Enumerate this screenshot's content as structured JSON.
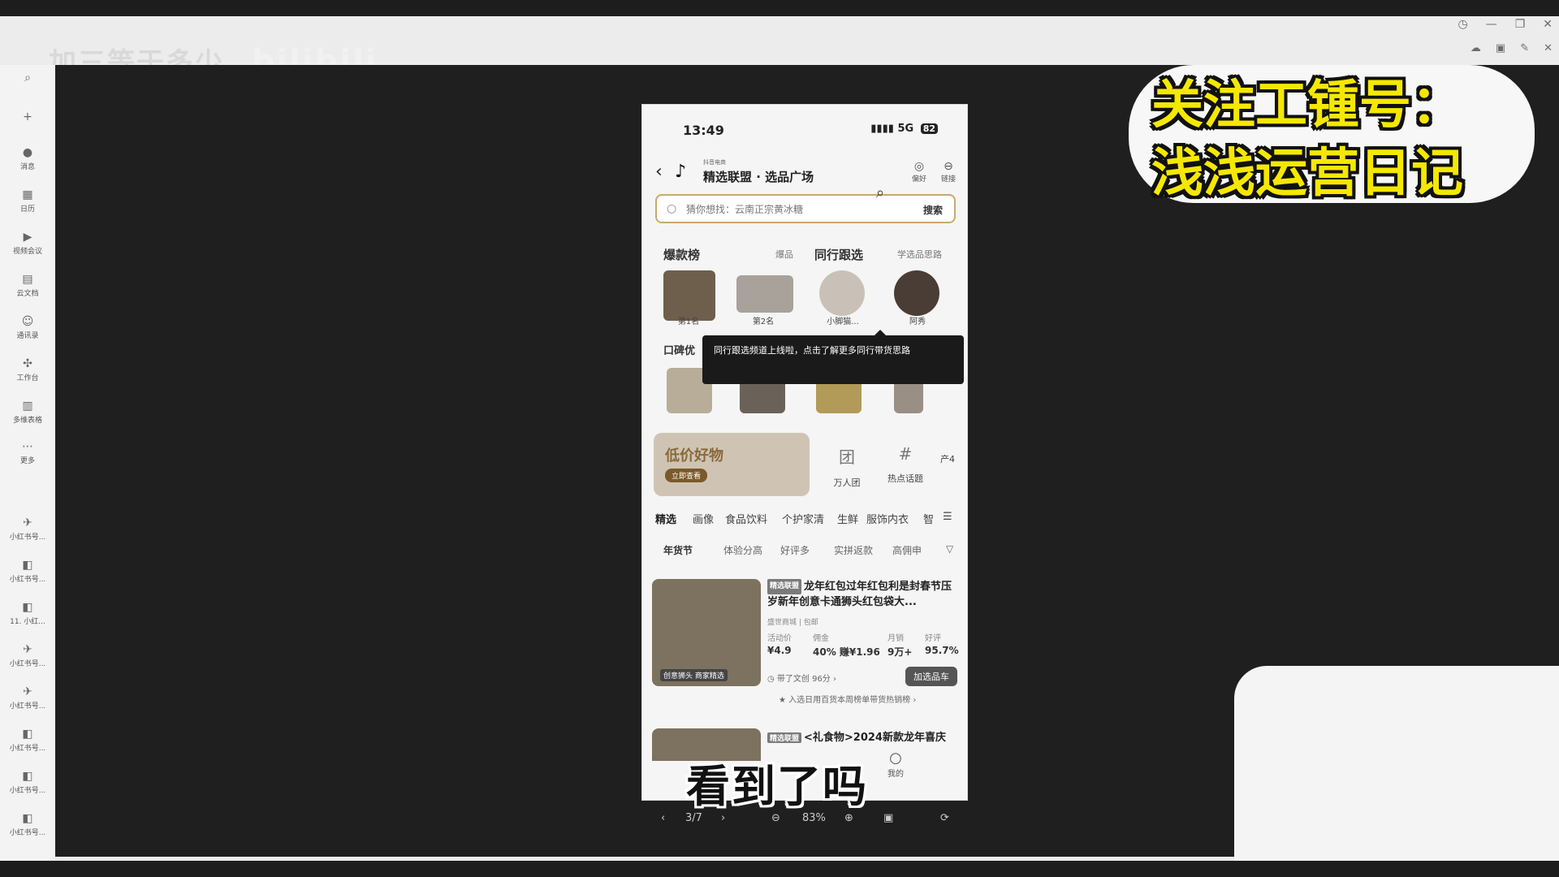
{
  "watermark": {
    "text": "加三等于多少",
    "brand": "bilibili"
  },
  "window": {
    "controls": [
      "◷",
      "—",
      "❐",
      "✕"
    ],
    "controls2": [
      "☁",
      "▣",
      "✎",
      "✕"
    ]
  },
  "sidebar": {
    "items": [
      {
        "icon": "⌕",
        "label": ""
      },
      {
        "icon": "+",
        "label": ""
      },
      {
        "icon": "●",
        "label": "消息"
      },
      {
        "icon": "▦",
        "label": "日历"
      },
      {
        "icon": "▶",
        "label": "视频会议"
      },
      {
        "icon": "▤",
        "label": "云文档"
      },
      {
        "icon": "☺",
        "label": "通讯录"
      },
      {
        "icon": "✣",
        "label": "工作台"
      },
      {
        "icon": "▥",
        "label": "多维表格"
      },
      {
        "icon": "⋯",
        "label": "更多"
      },
      {
        "icon": "✈",
        "label": "小红书号..."
      },
      {
        "icon": "◧",
        "label": "小红书号..."
      },
      {
        "icon": "◧",
        "label": "11. 小红..."
      },
      {
        "icon": "✈",
        "label": "小红书号..."
      },
      {
        "icon": "✈",
        "label": "小红书号..."
      },
      {
        "icon": "◧",
        "label": "小红书号..."
      },
      {
        "icon": "◧",
        "label": "小红书号..."
      },
      {
        "icon": "◧",
        "label": "小红书号..."
      }
    ]
  },
  "phone": {
    "time": "13:49",
    "signal": "5G",
    "battery": "82",
    "header": {
      "subtitle": "抖音电商",
      "title": "精选联盟 · 选品广场",
      "btn_fav": "偏好",
      "btn_link": "链接"
    },
    "search": {
      "placeholder": "猜你想找：云南正宗黄冰糖",
      "button": "搜索"
    },
    "section1": {
      "title": "爆款榜",
      "more": "爆品",
      "title2": "同行跟选",
      "more2": "学选品思路",
      "items": [
        "第1名",
        "第2名",
        "小脚猫...",
        "阿秀"
      ]
    },
    "section2": {
      "title": "口碑优"
    },
    "tooltip": "同行跟选频道上线啦，点击了解更多同行带货思路",
    "banner": {
      "text": "低价好物",
      "pill": "立即查看"
    },
    "shortcuts": [
      {
        "icon": "团",
        "label": "万人团"
      },
      {
        "icon": "#",
        "label": "热点话题"
      },
      {
        "icon": "",
        "label": "产4"
      }
    ],
    "categories": [
      "精选",
      "画像",
      "食品饮料",
      "个护家清",
      "生鲜",
      "服饰内衣",
      "智"
    ],
    "subcategories": [
      "年货节",
      "体验分高",
      "好评多",
      "实拼返款",
      "高佣申"
    ],
    "product1": {
      "tag": "精选联盟",
      "title": "龙年红包过年红包利是封春节压岁新年创意卡通狮头红包袋大...",
      "shop": "盛世商城  | 包邮",
      "stats": [
        {
          "label": "活动价",
          "value": "¥4.9"
        },
        {
          "label": "佣金",
          "value": "40% 赚¥1.96"
        },
        {
          "label": "月销",
          "value": "9万+"
        },
        {
          "label": "好评",
          "value": "95.7%"
        }
      ],
      "img_tag": "创意狮头 商家精选",
      "note": "◷ 带了文创 96分 ›",
      "button": "加选品车",
      "rank": "★ 入选日用百货本周榜单带货热销榜 ›"
    },
    "product2": {
      "tag": "精选联盟",
      "title": "<礼食物>2024新款龙年喜庆"
    },
    "tab_mine": "我的",
    "caption": "看到了吗"
  },
  "viewer": {
    "prev": "‹",
    "page": "3/7",
    "next": "›",
    "zoom_out": "⊖",
    "zoom": "83%",
    "zoom_in": "⊕",
    "fit": "▣",
    "rotate": "⟳"
  },
  "promo": {
    "line1": "关注工锺号：",
    "line2": "浅浅运营日记"
  },
  "colors": {
    "promo_yellow": "#f5e800",
    "search_border": "#c9a96a"
  }
}
